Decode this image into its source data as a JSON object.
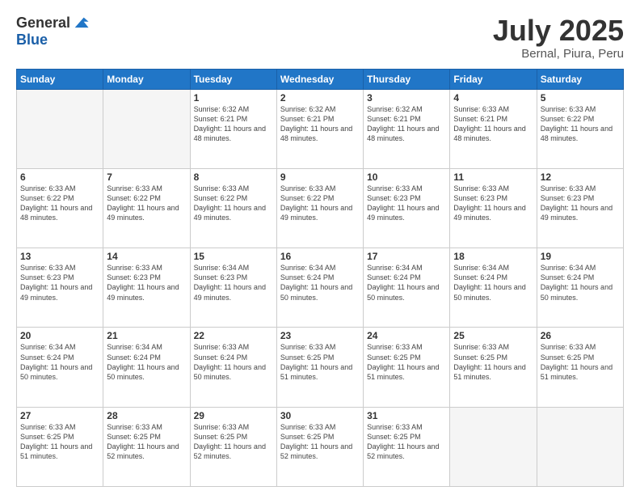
{
  "logo": {
    "general": "General",
    "blue": "Blue"
  },
  "header": {
    "month": "July 2025",
    "location": "Bernal, Piura, Peru"
  },
  "weekdays": [
    "Sunday",
    "Monday",
    "Tuesday",
    "Wednesday",
    "Thursday",
    "Friday",
    "Saturday"
  ],
  "weeks": [
    [
      {
        "day": "",
        "empty": true
      },
      {
        "day": "",
        "empty": true
      },
      {
        "day": "1",
        "sunrise": "6:32 AM",
        "sunset": "6:21 PM",
        "daylight": "11 hours and 48 minutes."
      },
      {
        "day": "2",
        "sunrise": "6:32 AM",
        "sunset": "6:21 PM",
        "daylight": "11 hours and 48 minutes."
      },
      {
        "day": "3",
        "sunrise": "6:32 AM",
        "sunset": "6:21 PM",
        "daylight": "11 hours and 48 minutes."
      },
      {
        "day": "4",
        "sunrise": "6:33 AM",
        "sunset": "6:21 PM",
        "daylight": "11 hours and 48 minutes."
      },
      {
        "day": "5",
        "sunrise": "6:33 AM",
        "sunset": "6:22 PM",
        "daylight": "11 hours and 48 minutes."
      }
    ],
    [
      {
        "day": "6",
        "sunrise": "6:33 AM",
        "sunset": "6:22 PM",
        "daylight": "11 hours and 48 minutes."
      },
      {
        "day": "7",
        "sunrise": "6:33 AM",
        "sunset": "6:22 PM",
        "daylight": "11 hours and 49 minutes."
      },
      {
        "day": "8",
        "sunrise": "6:33 AM",
        "sunset": "6:22 PM",
        "daylight": "11 hours and 49 minutes."
      },
      {
        "day": "9",
        "sunrise": "6:33 AM",
        "sunset": "6:22 PM",
        "daylight": "11 hours and 49 minutes."
      },
      {
        "day": "10",
        "sunrise": "6:33 AM",
        "sunset": "6:23 PM",
        "daylight": "11 hours and 49 minutes."
      },
      {
        "day": "11",
        "sunrise": "6:33 AM",
        "sunset": "6:23 PM",
        "daylight": "11 hours and 49 minutes."
      },
      {
        "day": "12",
        "sunrise": "6:33 AM",
        "sunset": "6:23 PM",
        "daylight": "11 hours and 49 minutes."
      }
    ],
    [
      {
        "day": "13",
        "sunrise": "6:33 AM",
        "sunset": "6:23 PM",
        "daylight": "11 hours and 49 minutes."
      },
      {
        "day": "14",
        "sunrise": "6:33 AM",
        "sunset": "6:23 PM",
        "daylight": "11 hours and 49 minutes."
      },
      {
        "day": "15",
        "sunrise": "6:34 AM",
        "sunset": "6:23 PM",
        "daylight": "11 hours and 49 minutes."
      },
      {
        "day": "16",
        "sunrise": "6:34 AM",
        "sunset": "6:24 PM",
        "daylight": "11 hours and 50 minutes."
      },
      {
        "day": "17",
        "sunrise": "6:34 AM",
        "sunset": "6:24 PM",
        "daylight": "11 hours and 50 minutes."
      },
      {
        "day": "18",
        "sunrise": "6:34 AM",
        "sunset": "6:24 PM",
        "daylight": "11 hours and 50 minutes."
      },
      {
        "day": "19",
        "sunrise": "6:34 AM",
        "sunset": "6:24 PM",
        "daylight": "11 hours and 50 minutes."
      }
    ],
    [
      {
        "day": "20",
        "sunrise": "6:34 AM",
        "sunset": "6:24 PM",
        "daylight": "11 hours and 50 minutes."
      },
      {
        "day": "21",
        "sunrise": "6:34 AM",
        "sunset": "6:24 PM",
        "daylight": "11 hours and 50 minutes."
      },
      {
        "day": "22",
        "sunrise": "6:33 AM",
        "sunset": "6:24 PM",
        "daylight": "11 hours and 50 minutes."
      },
      {
        "day": "23",
        "sunrise": "6:33 AM",
        "sunset": "6:25 PM",
        "daylight": "11 hours and 51 minutes."
      },
      {
        "day": "24",
        "sunrise": "6:33 AM",
        "sunset": "6:25 PM",
        "daylight": "11 hours and 51 minutes."
      },
      {
        "day": "25",
        "sunrise": "6:33 AM",
        "sunset": "6:25 PM",
        "daylight": "11 hours and 51 minutes."
      },
      {
        "day": "26",
        "sunrise": "6:33 AM",
        "sunset": "6:25 PM",
        "daylight": "11 hours and 51 minutes."
      }
    ],
    [
      {
        "day": "27",
        "sunrise": "6:33 AM",
        "sunset": "6:25 PM",
        "daylight": "11 hours and 51 minutes."
      },
      {
        "day": "28",
        "sunrise": "6:33 AM",
        "sunset": "6:25 PM",
        "daylight": "11 hours and 52 minutes."
      },
      {
        "day": "29",
        "sunrise": "6:33 AM",
        "sunset": "6:25 PM",
        "daylight": "11 hours and 52 minutes."
      },
      {
        "day": "30",
        "sunrise": "6:33 AM",
        "sunset": "6:25 PM",
        "daylight": "11 hours and 52 minutes."
      },
      {
        "day": "31",
        "sunrise": "6:33 AM",
        "sunset": "6:25 PM",
        "daylight": "11 hours and 52 minutes."
      },
      {
        "day": "",
        "empty": true
      },
      {
        "day": "",
        "empty": true
      }
    ]
  ],
  "labels": {
    "sunrise": "Sunrise:",
    "sunset": "Sunset:",
    "daylight": "Daylight:"
  }
}
